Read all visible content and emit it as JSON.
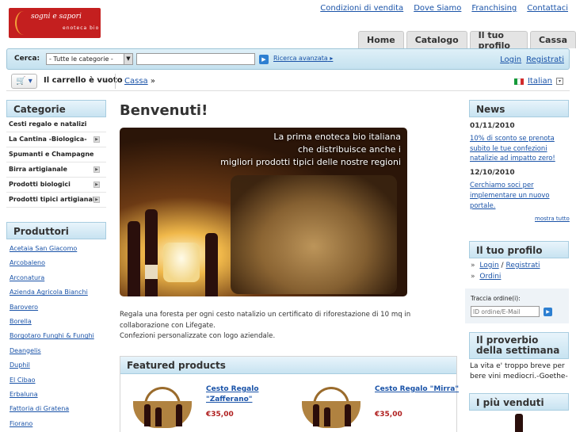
{
  "logo": {
    "text": "sogni e sapori",
    "subtext": "enoteca bio"
  },
  "toplinks": [
    "Condizioni di vendita",
    "Dove Siamo",
    "Franchising",
    "Contattaci"
  ],
  "tabs": [
    "Home",
    "Catalogo",
    "Il tuo profilo",
    "Cassa"
  ],
  "search": {
    "label": "Cerca:",
    "category_selected": "- Tutte le categorie -",
    "query": "",
    "advanced": "Ricerca avanzata"
  },
  "auth": {
    "login": "Login",
    "register": "Registrati"
  },
  "cart": {
    "status": "Il carrello è vuoto"
  },
  "breadcrumb": {
    "item": "Cassa",
    "sep": "»"
  },
  "language": {
    "label": "Italian",
    "flag_colors": [
      "#159a3a",
      "#ffffff",
      "#d22b2b"
    ]
  },
  "categories": {
    "title": "Categorie",
    "items": [
      {
        "label": "Cesti regalo e natalizi",
        "expandable": false
      },
      {
        "label": "La Cantina -Biologica-",
        "expandable": true
      },
      {
        "label": "Spumanti e Champagne",
        "expandable": false
      },
      {
        "label": "Birra artigianale",
        "expandable": true
      },
      {
        "label": "Prodotti biologici",
        "expandable": true
      },
      {
        "label": "Prodotti tipici artigianali",
        "expandable": true
      }
    ]
  },
  "producers": {
    "title": "Produttori",
    "items": [
      "Acetaia San Giacomo",
      "Arcobaleno",
      "Arconatura",
      "Azienda Agricola Bianchi",
      "Barovero",
      "Borella",
      "Borgotaro Funghi & Funghi",
      "Deangelis",
      "Duphil",
      "El Cibao",
      "Erbaluna",
      "Fattoria di Gratena",
      "Fiorano"
    ]
  },
  "main": {
    "title": "Benvenuti!",
    "hero_caption": [
      "La prima enoteca bio italiana",
      "che distribuisce anche i",
      "migliori prodotti tipici delle nostre regioni"
    ],
    "intro": [
      "Regala una foresta per ogni cesto natalizio un certificato di riforestazione di 10 mq in collaborazione con Lifegate.",
      "Confezioni personalizzate con logo aziendale."
    ]
  },
  "featured": {
    "title": "Featured products",
    "products": [
      {
        "name": "Cesto Regalo \"Zafferano\"",
        "price": "€35,00"
      },
      {
        "name": "Cesto Regalo \"Mirra\"",
        "price": "€35,00"
      }
    ]
  },
  "news": {
    "title": "News",
    "items": [
      {
        "date": "01/11/2010",
        "text": "10% di sconto se prenota subito le tue confezioni natalizie ad impatto zero!"
      },
      {
        "date": "12/10/2010",
        "text": "Cerchiamo soci per implementare un nuovo portale."
      }
    ],
    "more": "mostra tutto"
  },
  "profile": {
    "title": "Il tuo profilo",
    "login": "Login",
    "sep": "/",
    "register": "Registrati",
    "orders": "Ordini",
    "track_label": "Traccia ordine(i):",
    "track_placeholder": "ID ordine/E-Mail"
  },
  "proverb": {
    "title": "Il proverbio della settimana",
    "text": "La vita e' troppo breve per bere vini mediocri.-Goethe-"
  },
  "bestsellers": {
    "title": "I più venduti"
  }
}
